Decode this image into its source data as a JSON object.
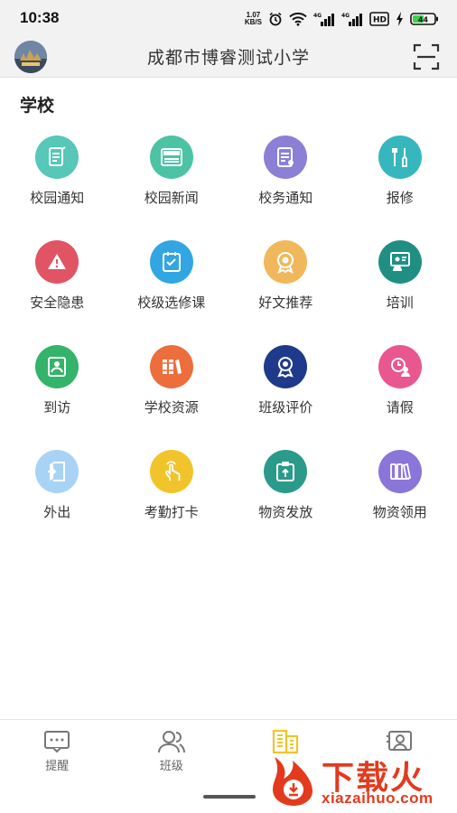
{
  "status_bar": {
    "time": "10:38",
    "net_speed_value": "1.07",
    "net_speed_unit": "KB/S",
    "battery": "44",
    "network_labels": [
      "4G",
      "4G",
      "HD"
    ]
  },
  "header": {
    "title": "成都市博睿测试小学",
    "avatar_icon": "avatar-photo",
    "scan_icon": "scan-icon"
  },
  "section": {
    "title": "学校"
  },
  "tiles": [
    {
      "label": "校园通知",
      "color": "#56c7b8",
      "icon": "notice-icon"
    },
    {
      "label": "校园新闻",
      "color": "#4cc3a4",
      "icon": "news-icon"
    },
    {
      "label": "校务通知",
      "color": "#8c7fd6",
      "icon": "document-icon"
    },
    {
      "label": "报修",
      "color": "#36b7bd",
      "icon": "tools-icon"
    },
    {
      "label": "安全隐患",
      "color": "#e05464",
      "icon": "warning-icon"
    },
    {
      "label": "校级选修课",
      "color": "#32a6e3",
      "icon": "checklist-icon"
    },
    {
      "label": "好文推荐",
      "color": "#f0b85a",
      "icon": "recommend-icon"
    },
    {
      "label": "培训",
      "color": "#1f8f84",
      "icon": "training-icon"
    },
    {
      "label": "到访",
      "color": "#34b36a",
      "icon": "visitor-icon"
    },
    {
      "label": "学校资源",
      "color": "#ec6e3c",
      "icon": "books-icon"
    },
    {
      "label": "班级评价",
      "color": "#1f3a8a",
      "icon": "badge-icon"
    },
    {
      "label": "请假",
      "color": "#e8578d",
      "icon": "leave-icon"
    },
    {
      "label": "外出",
      "color": "#a9d3f5",
      "icon": "door-icon"
    },
    {
      "label": "考勤打卡",
      "color": "#f2c42b",
      "icon": "hand-tap-icon"
    },
    {
      "label": "物资发放",
      "color": "#2a9b8b",
      "icon": "clipboard-icon"
    },
    {
      "label": "物资领用",
      "color": "#8a76d8",
      "icon": "supplies-icon"
    }
  ],
  "tabbar": {
    "items": [
      {
        "label": "提醒",
        "icon": "message-icon"
      },
      {
        "label": "班级",
        "icon": "users-icon"
      },
      {
        "label": "",
        "icon": "building-icon",
        "active_color": "#f2c42b"
      },
      {
        "label": "",
        "icon": "profile-card-icon"
      }
    ]
  },
  "watermark": {
    "text": "下载火",
    "sub": "xiazaihuo.com",
    "color": "#e33a1e"
  }
}
